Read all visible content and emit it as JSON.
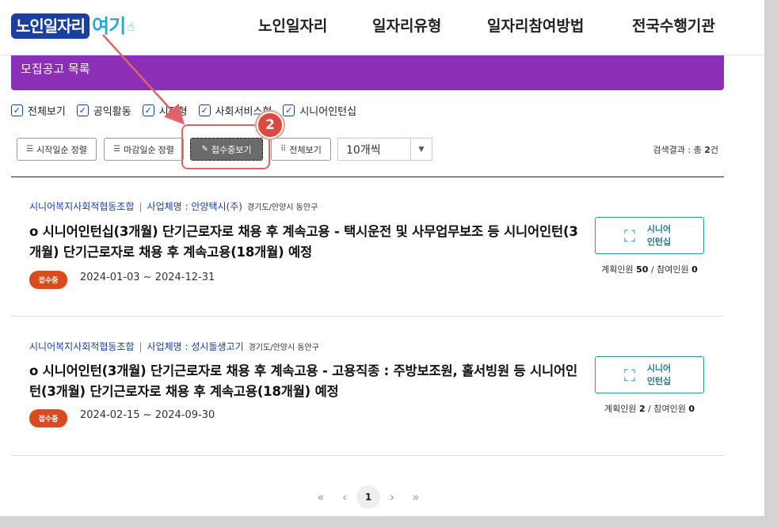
{
  "header": {
    "logo_main": "노인일자리",
    "logo_accent": "여기",
    "nav": [
      "노인일자리",
      "일자리유형",
      "일자리참여방법",
      "전국수행기관"
    ]
  },
  "banner": {
    "title": "모집공고 목록"
  },
  "filters": [
    {
      "label": "전체보기",
      "checked": true
    },
    {
      "label": "공익활동",
      "checked": true
    },
    {
      "label": "시장형",
      "checked": true
    },
    {
      "label": "사회서비스형",
      "checked": true
    },
    {
      "label": "시니어인턴십",
      "checked": true
    }
  ],
  "toolbar": {
    "sort_start": "시작일순 정렬",
    "sort_end": "마감일순 정렬",
    "view_open": "접수중보기",
    "view_all": "전체보기",
    "page_size": "10개씩",
    "result_prefix": "검색결과 : 총",
    "result_count": "2",
    "result_suffix": "건"
  },
  "annotation": {
    "step": "2"
  },
  "listings": [
    {
      "org": "시니어복지사회적협동조합",
      "company": "사업체명 : 안양택시(주)",
      "location": "경기도/안양시 동안구",
      "title": "o 시니어인턴십(3개월) 단기근로자로 채용 후 계속고용 - 택시운전 및 사무업무보조 등 시니어인턴(3개월) 단기근로자로 채용 후 계속고용(18개월) 예정",
      "status": "접수중",
      "dates": "2024-01-03 ~ 2024-12-31",
      "type_line1": "시니어",
      "type_line2": "인턴십",
      "planned_label": "계획인원",
      "planned": "50",
      "joined_label": "참여인원",
      "joined": "0"
    },
    {
      "org": "시니어복지사회적협동조합",
      "company": "사업체명 : 성시돌생고기",
      "location": "경기도/안양시 동안구",
      "title": "o 시니어인턴(3개월) 단기근로자로 채용 후 계속고용 - 고용직종 : 주방보조원, 홀서빙원 등 시니어인턴(3개월) 단기근로자로 채용 후 계속고용(18개월) 예정",
      "status": "접수중",
      "dates": "2024-02-15 ~ 2024-09-30",
      "type_line1": "시니어",
      "type_line2": "인턴십",
      "planned_label": "계획인원",
      "planned": "2",
      "joined_label": "참여인원",
      "joined": "0"
    }
  ],
  "pagination": {
    "current": "1"
  },
  "colors": {
    "brand_blue": "#1a3f9c",
    "banner_purple": "#8a2fb6",
    "status_orange": "#d94a1e",
    "type_teal": "#2a9ca6",
    "highlight_red": "#e0636c"
  }
}
